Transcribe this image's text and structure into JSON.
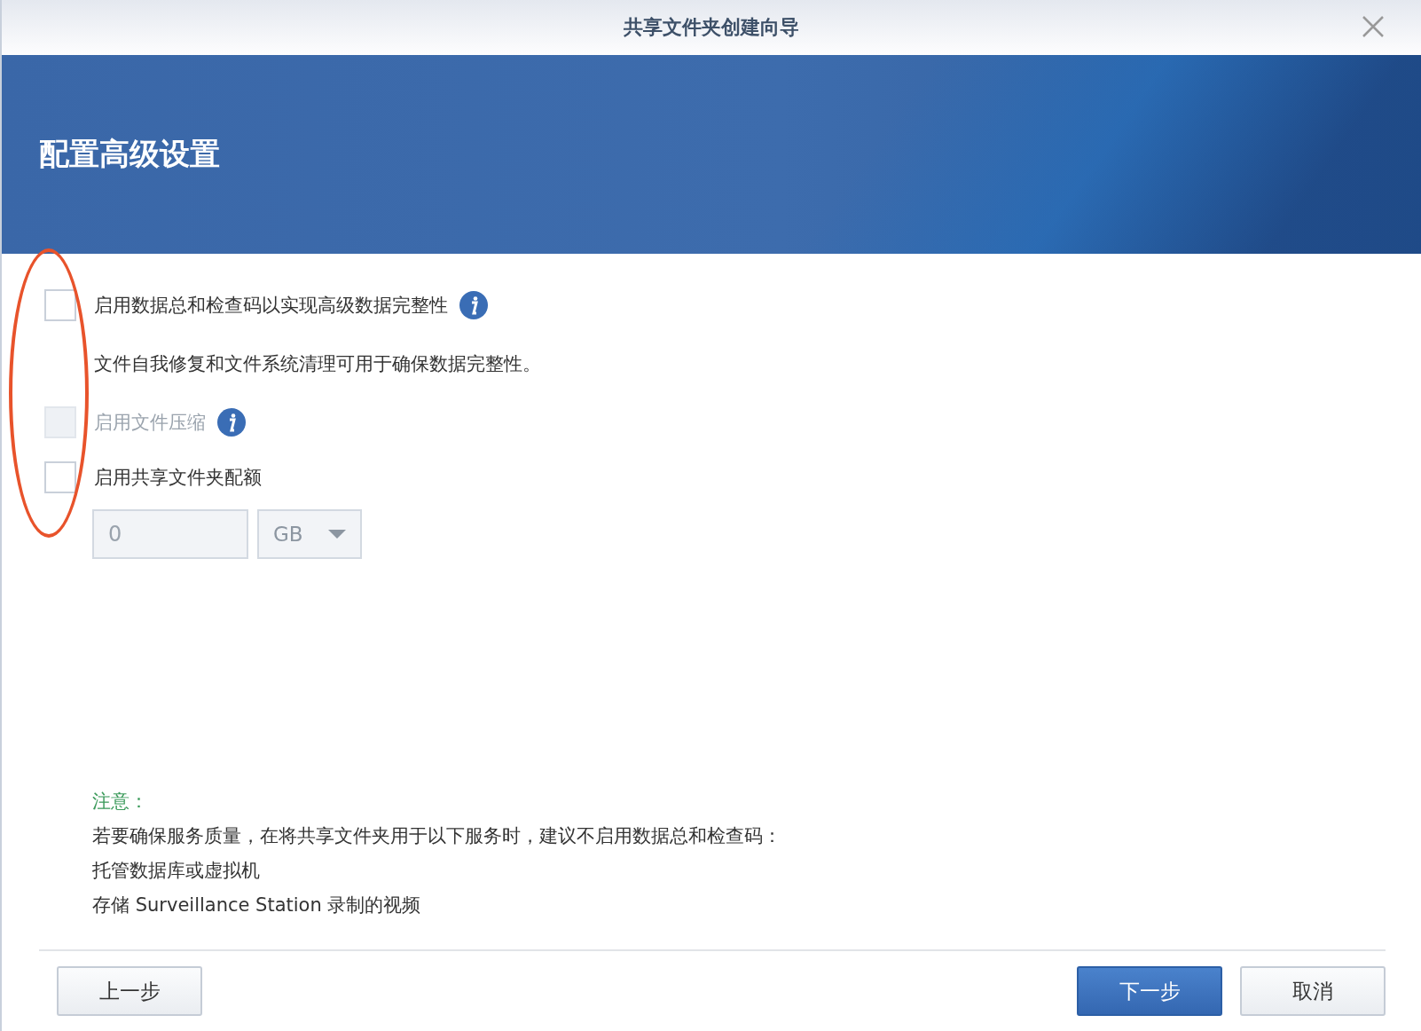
{
  "window": {
    "title": "共享文件夹创建向导"
  },
  "header": {
    "title": "配置高级设置"
  },
  "options": [
    {
      "kind": "checkbox",
      "label": "启用数据总和检查码以实现高级数据完整性",
      "checked": false,
      "disabled": false,
      "info": true
    },
    {
      "kind": "text",
      "label": "文件自我修复和文件系统清理可用于确保数据完整性。"
    },
    {
      "kind": "checkbox",
      "label": "启用文件压缩",
      "checked": false,
      "disabled": true,
      "info": true
    },
    {
      "kind": "checkbox",
      "label": "启用共享文件夹配额",
      "checked": false,
      "disabled": false,
      "info": false
    }
  ],
  "quota": {
    "value": "0",
    "unit": "GB",
    "disabled": true
  },
  "note": {
    "title": "注意：",
    "lines": [
      "若要确保服务质量，在将共享文件夹用于以下服务时，建议不启用数据总和检查码：",
      "托管数据库或虚拟机",
      "存储 Surveillance Station 录制的视频"
    ]
  },
  "buttons": [
    {
      "label": "上一步",
      "primary": false
    },
    {
      "label": "下一步",
      "primary": true
    },
    {
      "label": "取消",
      "primary": false
    }
  ]
}
